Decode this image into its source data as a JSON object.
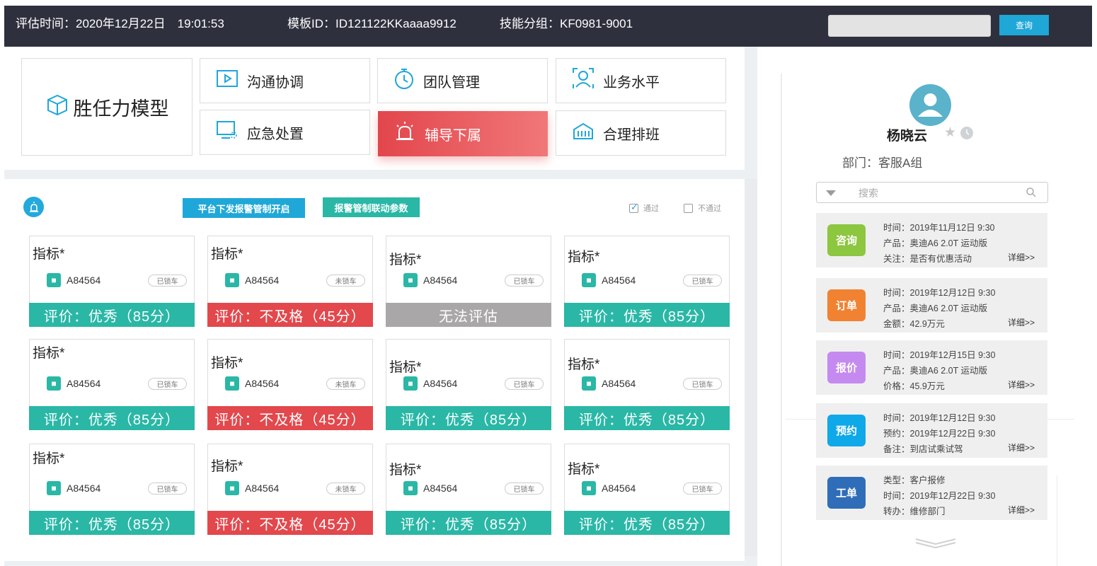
{
  "header": {
    "eval_time": "评估时间：2020年12月22日　19:01:53",
    "template_id": "模板ID：ID121122KKaaaa9912",
    "skill_group": "技能分组：KF0981-9001",
    "search_value": "",
    "query_label": "查询"
  },
  "model": {
    "title": "胜任力模型"
  },
  "categories": [
    {
      "label": "沟通协调",
      "icon": "play-icon"
    },
    {
      "label": "团队管理",
      "icon": "stopwatch-icon"
    },
    {
      "label": "业务水平",
      "icon": "user-scan-icon"
    },
    {
      "label": "应急处置",
      "icon": "monitor-alert-icon"
    },
    {
      "label": "辅导下属",
      "icon": "alarm-light-icon",
      "active": true
    },
    {
      "label": "合理排班",
      "icon": "schedule-icon"
    }
  ],
  "toolbar": {
    "alarm_icon": "alarm-light-icon",
    "platform_btn": "平台下发报警管制开启",
    "linkage_btn": "报警管制联动参数",
    "pass_label": "通过",
    "pass_checked": true,
    "fail_label": "不通过",
    "fail_checked": false
  },
  "cards": [
    {
      "title": "指标*",
      "code": "A84564",
      "tag": "已锁车",
      "rating": "评价：优秀（85分）",
      "status": "good"
    },
    {
      "title": "指标*",
      "code": "A84564",
      "tag": "未锁车",
      "rating": "评价：不及格（45分）",
      "status": "bad"
    },
    {
      "title": "指标*",
      "code": "A84564",
      "tag": "已锁车",
      "rating": "无法评估",
      "status": "na"
    },
    {
      "title": "指标*",
      "code": "A84564",
      "tag": "已锁车",
      "rating": "评价：优秀（85分）",
      "status": "good"
    },
    {
      "title": "指标*",
      "code": "A84564",
      "tag": "已锁车",
      "rating": "评价：优秀（85分）",
      "status": "good"
    },
    {
      "title": "指标*",
      "code": "A84564",
      "tag": "未锁车",
      "rating": "评价：不及格（45分）",
      "status": "bad"
    },
    {
      "title": "指标*",
      "code": "A84564",
      "tag": "已锁车",
      "rating": "评价：优秀（85分）",
      "status": "good"
    },
    {
      "title": "指标*",
      "code": "A84564",
      "tag": "已锁车",
      "rating": "评价：优秀（85分）",
      "status": "good"
    },
    {
      "title": "指标*",
      "code": "A84564",
      "tag": "已锁车",
      "rating": "评价：优秀（85分）",
      "status": "good"
    },
    {
      "title": "指标*",
      "code": "A84564",
      "tag": "未锁车",
      "rating": "评价：不及格（45分）",
      "status": "bad"
    },
    {
      "title": "指标*",
      "code": "A84564",
      "tag": "已锁车",
      "rating": "评价：优秀（85分）",
      "status": "good"
    },
    {
      "title": "指标*",
      "code": "A84564",
      "tag": "已锁车",
      "rating": "评价：优秀（85分）",
      "status": "good"
    }
  ],
  "profile": {
    "name": "杨晓云",
    "department": "部门：客服A组",
    "search_placeholder": "搜索"
  },
  "records": [
    {
      "badge": "咨询",
      "color": "#8dc63f",
      "lines": [
        "时间：2019年11月12日 9:30",
        "产品：奥迪A6 2.0T 运动版",
        "关注：是否有优惠活动"
      ],
      "detail": "详细>>"
    },
    {
      "badge": "订单",
      "color": "#f08232",
      "lines": [
        "时间：2019年12月12日 9:30",
        "产品：奥迪A6 2.0T 运动版",
        "金额：42.9万元"
      ],
      "detail": "详细>>"
    },
    {
      "badge": "报价",
      "color": "#c58af0",
      "lines": [
        "时间：2019年12月15日 9:30",
        "产品：奥迪A6 2.0T 运动版",
        "价格：45.9万元"
      ],
      "detail": "详细>>"
    },
    {
      "badge": "预约",
      "color": "#0fa8e8",
      "lines": [
        "时间：2019年12月12日 9:30",
        "预约：2019年12月22日 9:30",
        "备注：到店试乘试驾"
      ],
      "detail": "详细>>"
    },
    {
      "badge": "工单",
      "color": "#2f6db8",
      "lines": [
        "类型：客户报修",
        "时间：2019年12月22日 9:30",
        "转办：维修部门"
      ],
      "detail": "详细>>"
    }
  ],
  "colors": {
    "header_bg": "#2e303d",
    "accent_blue": "#1fa7d8",
    "teal": "#2ab7a6",
    "red": "#e2484c",
    "gray": "#a9a7a7"
  }
}
